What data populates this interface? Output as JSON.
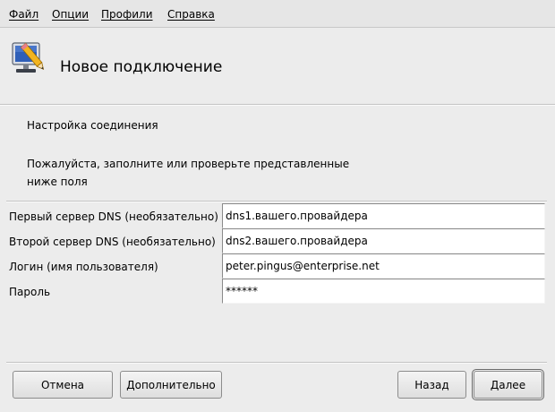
{
  "menu": {
    "items": [
      {
        "label": "Файл"
      },
      {
        "label": "Опции"
      },
      {
        "label": "Профили"
      },
      {
        "label": "Справка"
      }
    ]
  },
  "header": {
    "title": "Новое подключение",
    "icon": "monitor-pencil-icon"
  },
  "content": {
    "section_title": "Настройка соединения",
    "instruction": "Пожалуйста, заполните или проверьте представленные ниже поля"
  },
  "form": {
    "fields": [
      {
        "label": "Первый сервер DNS (необязательно)",
        "value": "dns1.вашего.провайдера"
      },
      {
        "label": "Второй сервер DNS (необязательно)",
        "value": "dns2.вашего.провайдера"
      },
      {
        "label": "Логин (имя пользователя)",
        "value": "peter.pingus@enterprise.net"
      },
      {
        "label": "Пароль",
        "value": "******"
      }
    ]
  },
  "buttons": {
    "cancel": "Отмена",
    "advanced": "Дополнительно",
    "back": "Назад",
    "next": "Далее"
  }
}
